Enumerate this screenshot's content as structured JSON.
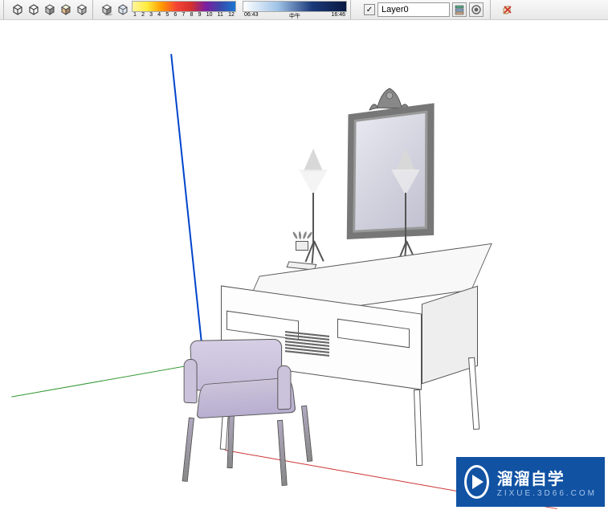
{
  "toolbar": {
    "rainbow_ticks": [
      "1",
      "2",
      "3",
      "4",
      "5",
      "6",
      "7",
      "8",
      "9",
      "10",
      "11",
      "12"
    ],
    "shadow_start": "06:43",
    "shadow_mid": "中午",
    "shadow_end": "16:46"
  },
  "layers": {
    "check": "✓",
    "current": "Layer0"
  },
  "watermark": {
    "title": "溜溜自学",
    "sub": "ZIXUE.3D66.COM"
  }
}
